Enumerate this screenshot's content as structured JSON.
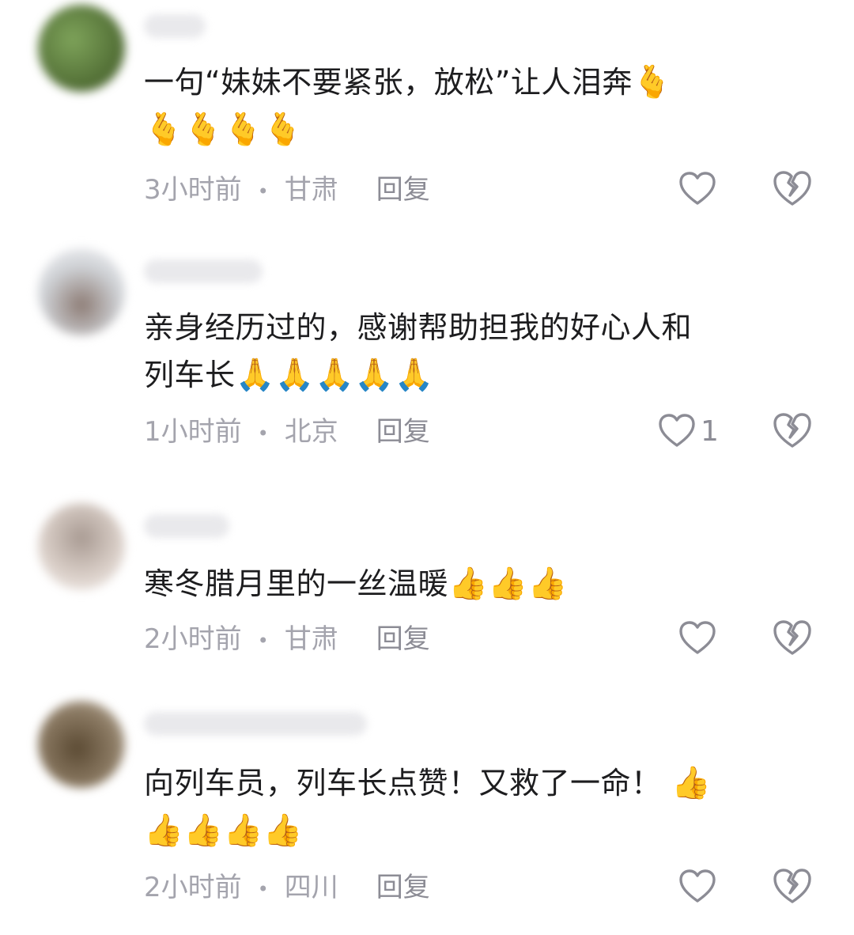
{
  "comments": [
    {
      "text": "一句“妹妹不要紧张，放松”让人泪奔",
      "emoji_inline": "🫰",
      "emoji_line2": "🫰🫰🫰🫰",
      "time": "3小时前",
      "location": "甘肃",
      "reply_label": "回复",
      "like_count": "",
      "avatar_color": "#6c8a45"
    },
    {
      "text": "亲身经历过的，感谢帮助担我的好心人和",
      "text_line2": "列车长",
      "emoji_line2": "🙏🙏🙏🙏🙏",
      "time": "1小时前",
      "location": "北京",
      "reply_label": "回复",
      "like_count": "1",
      "avatar_color": "#b7b8bb"
    },
    {
      "text": "寒冬腊月里的一丝温暖",
      "emoji_inline": "👍👍👍",
      "time": "2小时前",
      "location": "甘肃",
      "reply_label": "回复",
      "like_count": "",
      "avatar_color": "#cdbfb6"
    },
    {
      "text": "向列车员，列车长点赞！又救了一命！",
      "emoji_inline": "👍",
      "emoji_line2": "👍👍👍👍",
      "time": "2小时前",
      "location": "四川",
      "reply_label": "回复",
      "like_count": "",
      "avatar_color": "#7a6a55"
    }
  ],
  "icons": {
    "like": "heart-outline-icon",
    "dislike": "broken-heart-icon"
  },
  "colors": {
    "text": "#1d1d1f",
    "meta": "#a4a4ad",
    "icon": "#8c8c95"
  }
}
